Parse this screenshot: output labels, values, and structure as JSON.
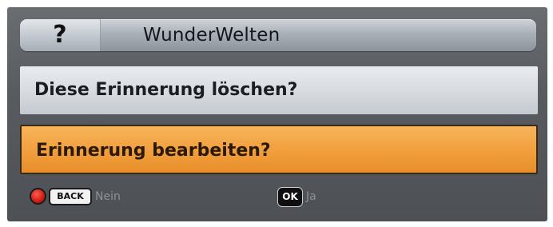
{
  "dialog": {
    "title": "WunderWelten",
    "title_icon": "question-mark-icon",
    "title_icon_glyph": "?"
  },
  "options": {
    "delete_label": "Diese Erinnerung löschen?",
    "edit_label": "Erinnerung bearbeiten?",
    "selected": "edit"
  },
  "footer": {
    "back_key_label": "BACK",
    "no_label": "Nein",
    "ok_key_label": "OK",
    "yes_label": "Ja"
  },
  "colors": {
    "highlight": "#f2a03e",
    "dialog_bg": "#585b60",
    "red_button": "#d91e10"
  }
}
